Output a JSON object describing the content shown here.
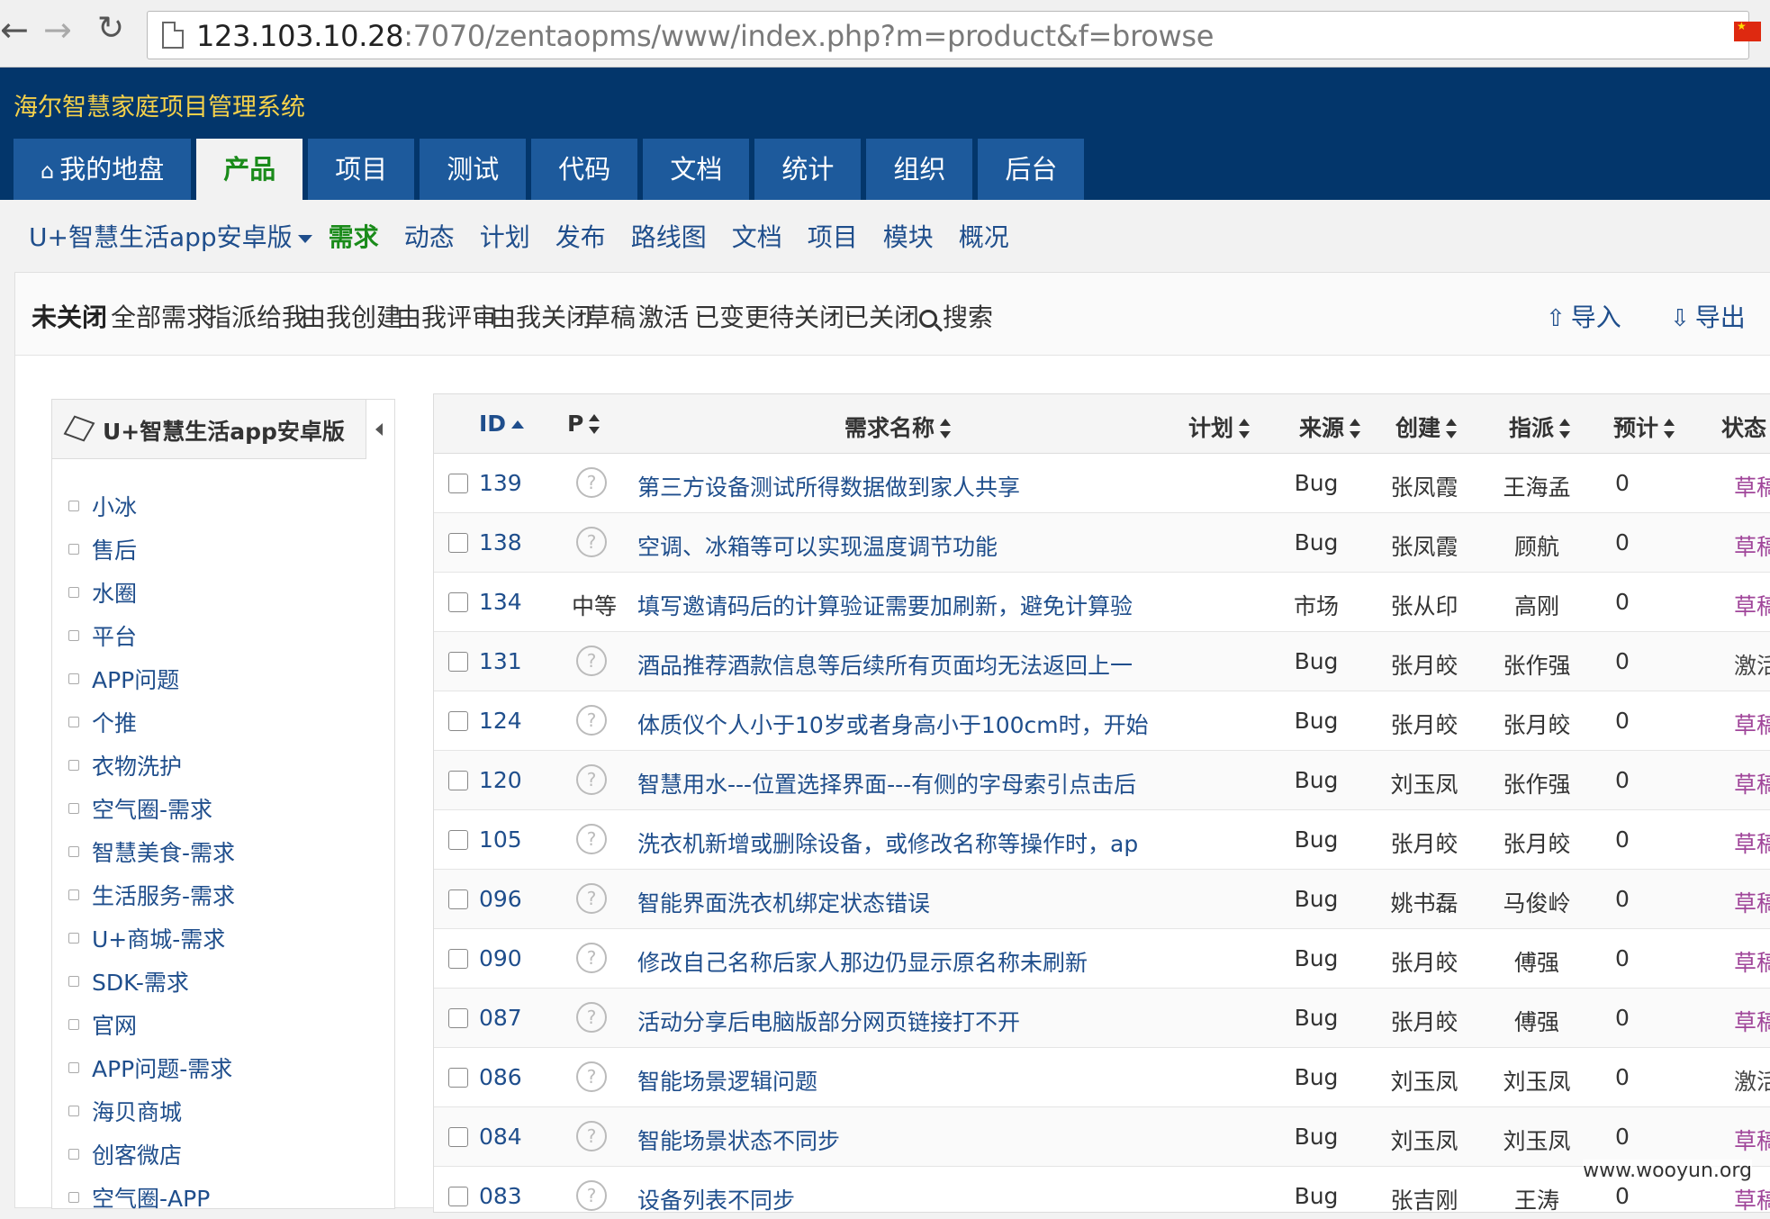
{
  "browser": {
    "url_host": "123.103.10.28",
    "url_rest": ":7070/zentaopms/www/index.php?m=product&f=browse"
  },
  "header": {
    "title": "海尔智慧家庭项目管理系统",
    "tabs": [
      {
        "label": "我的地盘",
        "icon": "home-icon"
      },
      {
        "label": "产品",
        "active": true
      },
      {
        "label": "项目"
      },
      {
        "label": "测试"
      },
      {
        "label": "代码"
      },
      {
        "label": "文档"
      },
      {
        "label": "统计"
      },
      {
        "label": "组织"
      },
      {
        "label": "后台"
      }
    ]
  },
  "subnav": {
    "product": "U+智慧生活app安卓版",
    "items": [
      "需求",
      "动态",
      "计划",
      "发布",
      "路线图",
      "文档",
      "项目",
      "模块",
      "概况"
    ]
  },
  "features": {
    "items": [
      "未关闭",
      "全部需求",
      "指派给我",
      "由我创建",
      "由我评审",
      "由我关闭",
      "草稿",
      "激活",
      "已变更",
      "待关闭",
      "已关闭"
    ],
    "search": "搜索",
    "import": "导入",
    "export": "导出"
  },
  "tree": {
    "title": "U+智慧生活app安卓版",
    "items": [
      "小冰",
      "售后",
      "水圈",
      "平台",
      "APP问题",
      "个推",
      "衣物洗护",
      "空气圈-需求",
      "智慧美食-需求",
      "生活服务-需求",
      "U+商城-需求",
      "SDK-需求",
      "官网",
      "APP问题-需求",
      "海贝商城",
      "创客微店",
      "空气圈-APP"
    ]
  },
  "table": {
    "headers": {
      "id": "ID",
      "pri": "P",
      "title": "需求名称",
      "plan": "计划",
      "source": "来源",
      "creator": "创建",
      "assign": "指派",
      "estimate": "预计",
      "status": "状态"
    },
    "rows": [
      {
        "id": "139",
        "pri": "",
        "title": "第三方设备测试所得数据做到家人共享",
        "source": "Bug",
        "creator": "张凤霞",
        "assign": "王海孟",
        "est": "0",
        "status": "草稿"
      },
      {
        "id": "138",
        "pri": "",
        "title": "空调、冰箱等可以实现温度调节功能",
        "source": "Bug",
        "creator": "张凤霞",
        "assign": "顾航",
        "est": "0",
        "status": "草稿"
      },
      {
        "id": "134",
        "pri": "中等",
        "title": "填写邀请码后的计算验证需要加刷新，避免计算验",
        "source": "市场",
        "creator": "张从印",
        "assign": "高刚",
        "est": "0",
        "status": "草稿"
      },
      {
        "id": "131",
        "pri": "",
        "title": "酒品推荐酒款信息等后续所有页面均无法返回上一",
        "source": "Bug",
        "creator": "张月皎",
        "assign": "张作强",
        "est": "0",
        "status": "激活"
      },
      {
        "id": "124",
        "pri": "",
        "title": "体质仪个人小于10岁或者身高小于100cm时，开始",
        "source": "Bug",
        "creator": "张月皎",
        "assign": "张月皎",
        "est": "0",
        "status": "草稿"
      },
      {
        "id": "120",
        "pri": "",
        "title": "智慧用水---位置选择界面---有侧的字母索引点击后",
        "source": "Bug",
        "creator": "刘玉凤",
        "assign": "张作强",
        "est": "0",
        "status": "草稿"
      },
      {
        "id": "105",
        "pri": "",
        "title": "洗衣机新增或删除设备，或修改名称等操作时，ap",
        "source": "Bug",
        "creator": "张月皎",
        "assign": "张月皎",
        "est": "0",
        "status": "草稿"
      },
      {
        "id": "096",
        "pri": "",
        "title": "智能界面洗衣机绑定状态错误",
        "source": "Bug",
        "creator": "姚书磊",
        "assign": "马俊岭",
        "est": "0",
        "status": "草稿"
      },
      {
        "id": "090",
        "pri": "",
        "title": "修改自己名称后家人那边仍显示原名称未刷新",
        "source": "Bug",
        "creator": "张月皎",
        "assign": "傅强",
        "est": "0",
        "status": "草稿"
      },
      {
        "id": "087",
        "pri": "",
        "title": "活动分享后电脑版部分网页链接打不开",
        "source": "Bug",
        "creator": "张月皎",
        "assign": "傅强",
        "est": "0",
        "status": "草稿"
      },
      {
        "id": "086",
        "pri": "",
        "title": "智能场景逻辑问题",
        "source": "Bug",
        "creator": "刘玉凤",
        "assign": "刘玉凤",
        "est": "0",
        "status": "激活"
      },
      {
        "id": "084",
        "pri": "",
        "title": "智能场景状态不同步",
        "source": "Bug",
        "creator": "刘玉凤",
        "assign": "刘玉凤",
        "est": "0",
        "status": "草稿"
      },
      {
        "id": "083",
        "pri": "",
        "title": "设备列表不同步",
        "source": "Bug",
        "creator": "张吉刚",
        "assign": "王涛",
        "est": "0",
        "status": "草稿"
      }
    ]
  },
  "watermark": "www.wooyun.org"
}
